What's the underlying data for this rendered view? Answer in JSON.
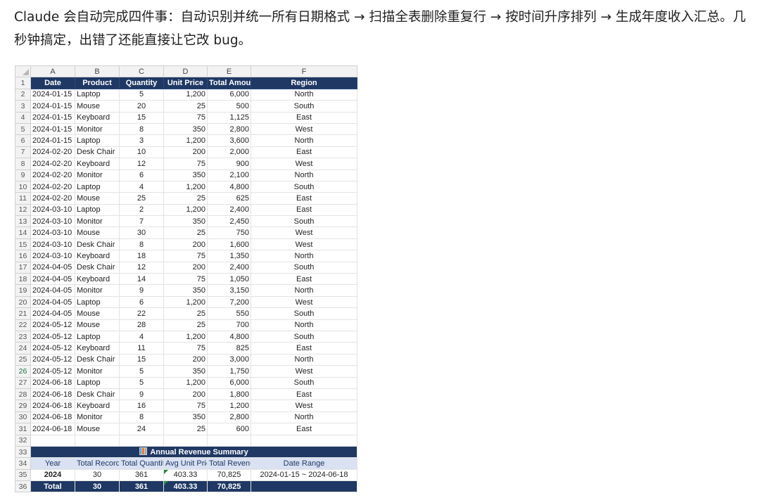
{
  "intro": "Claude 会自动完成四件事：自动识别并统一所有日期格式 → 扫描全表删除重复行 → 按时间升序排列 → 生成年度收入汇总。几秒钟搞定，出错了还能直接让它改 bug。",
  "columns": [
    "A",
    "B",
    "C",
    "D",
    "E",
    "F"
  ],
  "header": [
    "Date",
    "Product",
    "Quantity",
    "Unit Price",
    "Total Amount",
    "Region"
  ],
  "rows": [
    [
      "2024-01-15",
      "Laptop",
      "5",
      "1,200",
      "6,000",
      "North"
    ],
    [
      "2024-01-15",
      "Mouse",
      "20",
      "25",
      "500",
      "South"
    ],
    [
      "2024-01-15",
      "Keyboard",
      "15",
      "75",
      "1,125",
      "East"
    ],
    [
      "2024-01-15",
      "Monitor",
      "8",
      "350",
      "2,800",
      "West"
    ],
    [
      "2024-01-15",
      "Laptop",
      "3",
      "1,200",
      "3,600",
      "North"
    ],
    [
      "2024-02-20",
      "Desk Chair",
      "10",
      "200",
      "2,000",
      "East"
    ],
    [
      "2024-02-20",
      "Keyboard",
      "12",
      "75",
      "900",
      "West"
    ],
    [
      "2024-02-20",
      "Monitor",
      "6",
      "350",
      "2,100",
      "North"
    ],
    [
      "2024-02-20",
      "Laptop",
      "4",
      "1,200",
      "4,800",
      "South"
    ],
    [
      "2024-02-20",
      "Mouse",
      "25",
      "25",
      "625",
      "East"
    ],
    [
      "2024-03-10",
      "Laptop",
      "2",
      "1,200",
      "2,400",
      "East"
    ],
    [
      "2024-03-10",
      "Monitor",
      "7",
      "350",
      "2,450",
      "South"
    ],
    [
      "2024-03-10",
      "Mouse",
      "30",
      "25",
      "750",
      "West"
    ],
    [
      "2024-03-10",
      "Desk Chair",
      "8",
      "200",
      "1,600",
      "West"
    ],
    [
      "2024-03-10",
      "Keyboard",
      "18",
      "75",
      "1,350",
      "North"
    ],
    [
      "2024-04-05",
      "Desk Chair",
      "12",
      "200",
      "2,400",
      "South"
    ],
    [
      "2024-04-05",
      "Keyboard",
      "14",
      "75",
      "1,050",
      "East"
    ],
    [
      "2024-04-05",
      "Monitor",
      "9",
      "350",
      "3,150",
      "North"
    ],
    [
      "2024-04-05",
      "Laptop",
      "6",
      "1,200",
      "7,200",
      "West"
    ],
    [
      "2024-04-05",
      "Mouse",
      "22",
      "25",
      "550",
      "South"
    ],
    [
      "2024-05-12",
      "Mouse",
      "28",
      "25",
      "700",
      "North"
    ],
    [
      "2024-05-12",
      "Laptop",
      "4",
      "1,200",
      "4,800",
      "South"
    ],
    [
      "2024-05-12",
      "Keyboard",
      "11",
      "75",
      "825",
      "East"
    ],
    [
      "2024-05-12",
      "Desk Chair",
      "15",
      "200",
      "3,000",
      "North"
    ],
    [
      "2024-05-12",
      "Monitor",
      "5",
      "350",
      "1,750",
      "West"
    ],
    [
      "2024-06-18",
      "Laptop",
      "5",
      "1,200",
      "6,000",
      "South"
    ],
    [
      "2024-06-18",
      "Desk Chair",
      "9",
      "200",
      "1,800",
      "East"
    ],
    [
      "2024-06-18",
      "Keyboard",
      "16",
      "75",
      "1,200",
      "West"
    ],
    [
      "2024-06-18",
      "Monitor",
      "8",
      "350",
      "2,800",
      "North"
    ],
    [
      "2024-06-18",
      "Mouse",
      "24",
      "25",
      "600",
      "East"
    ]
  ],
  "selected_row": 26,
  "summary": {
    "title": "Annual Revenue Summary",
    "title_icon": "bar-chart-icon",
    "headers": [
      "Year",
      "Total Records",
      "Total Quantity",
      "Avg Unit Price",
      "Total Revenue",
      "Date Range"
    ],
    "row": [
      "2024",
      "30",
      "361",
      "403.33",
      "70,825",
      "2024-01-15 ~ 2024-06-18"
    ],
    "total": [
      "Total",
      "30",
      "361",
      "403.33",
      "70,825",
      ""
    ]
  },
  "colors": {
    "header_bg": "#1f3864",
    "subheader_bg": "#d9e1f2",
    "error_flag": "#1e8a3e"
  }
}
